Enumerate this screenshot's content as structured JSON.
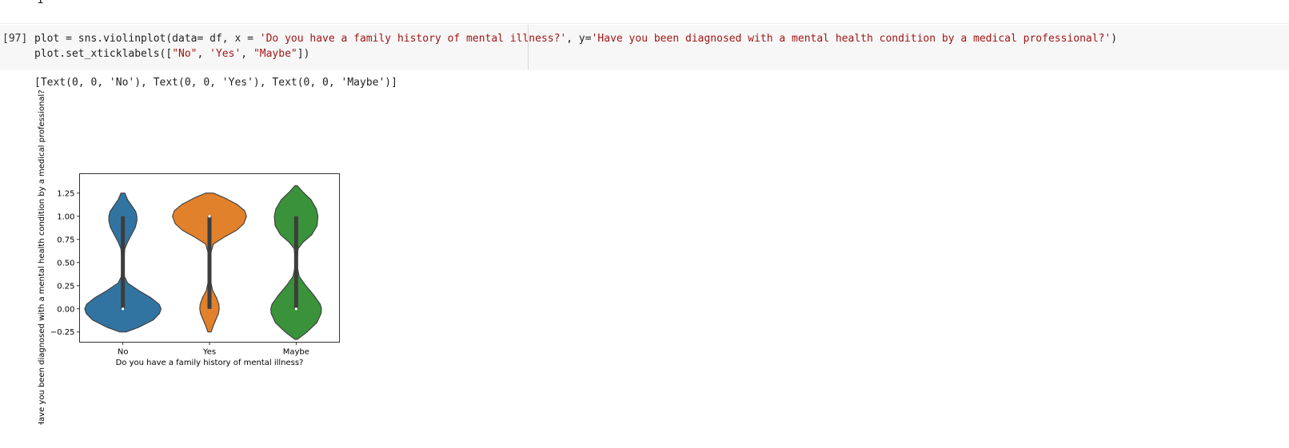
{
  "previous_output": "1",
  "cell": {
    "execution_count": "[97]",
    "code_line_1": [
      {
        "t": "plot = sns.violinplot(data= df, x = ",
        "s": false
      },
      {
        "t": "'Do you have a family history of mental illness?'",
        "s": true
      },
      {
        "t": ", y=",
        "s": false
      },
      {
        "t": "'Have you been diagnosed with a mental health condition by a medical professional?'",
        "s": true
      },
      {
        "t": ")",
        "s": false
      }
    ],
    "code_line_2": [
      {
        "t": "plot.set_xticklabels([",
        "s": false
      },
      {
        "t": "\"No\"",
        "s": true
      },
      {
        "t": ", ",
        "s": false
      },
      {
        "t": "'Yes'",
        "s": true
      },
      {
        "t": ", ",
        "s": false
      },
      {
        "t": "\"Maybe\"",
        "s": true
      },
      {
        "t": "])",
        "s": false
      }
    ]
  },
  "output_text": "[Text(0, 0, 'No'), Text(0, 0, 'Yes'), Text(0, 0, 'Maybe')]",
  "chart_data": {
    "type": "violin",
    "categories": [
      "No",
      "Yes",
      "Maybe"
    ],
    "xlabel": "Do you have a family history of mental illness?",
    "ylabel": "Have you been diagnosed with a mental health condition by a medical professional?",
    "ylim": [
      -0.36,
      1.46
    ],
    "yticks": [
      -0.25,
      0.0,
      0.25,
      0.5,
      0.75,
      1.0,
      1.25
    ],
    "ytick_labels": [
      "−0.25",
      "0.00",
      "0.25",
      "0.50",
      "0.75",
      "1.00",
      "1.25"
    ],
    "colors": [
      "#3274a1",
      "#e1812c",
      "#3a923a"
    ],
    "series": [
      {
        "name": "No",
        "extent": [
          -0.25,
          1.25
        ],
        "box": {
          "q1": 0.0,
          "q3": 1.0,
          "median": 0.0,
          "whisker_low": 0.0,
          "whisker_high": 1.0
        },
        "density": [
          [
            -0.25,
            0.08
          ],
          [
            -0.2,
            0.4
          ],
          [
            -0.12,
            0.78
          ],
          [
            -0.05,
            0.94
          ],
          [
            0.0,
            0.98
          ],
          [
            0.05,
            0.93
          ],
          [
            0.12,
            0.72
          ],
          [
            0.2,
            0.4
          ],
          [
            0.28,
            0.12
          ],
          [
            0.35,
            0.04
          ],
          [
            0.45,
            0.03
          ],
          [
            0.55,
            0.03
          ],
          [
            0.65,
            0.05
          ],
          [
            0.72,
            0.12
          ],
          [
            0.8,
            0.22
          ],
          [
            0.88,
            0.32
          ],
          [
            0.95,
            0.36
          ],
          [
            1.0,
            0.36
          ],
          [
            1.05,
            0.33
          ],
          [
            1.12,
            0.22
          ],
          [
            1.18,
            0.12
          ],
          [
            1.25,
            0.05
          ]
        ]
      },
      {
        "name": "Yes",
        "extent": [
          -0.25,
          1.25
        ],
        "box": {
          "q1": 0.0,
          "q3": 1.0,
          "median": 1.0,
          "whisker_low": 0.0,
          "whisker_high": 1.0
        },
        "density": [
          [
            -0.25,
            0.04
          ],
          [
            -0.18,
            0.1
          ],
          [
            -0.1,
            0.18
          ],
          [
            -0.05,
            0.23
          ],
          [
            0.0,
            0.25
          ],
          [
            0.05,
            0.24
          ],
          [
            0.12,
            0.18
          ],
          [
            0.2,
            0.08
          ],
          [
            0.3,
            0.03
          ],
          [
            0.45,
            0.02
          ],
          [
            0.6,
            0.03
          ],
          [
            0.7,
            0.1
          ],
          [
            0.78,
            0.4
          ],
          [
            0.85,
            0.7
          ],
          [
            0.92,
            0.88
          ],
          [
            1.0,
            0.95
          ],
          [
            1.06,
            0.9
          ],
          [
            1.13,
            0.7
          ],
          [
            1.2,
            0.38
          ],
          [
            1.25,
            0.1
          ]
        ]
      },
      {
        "name": "Maybe",
        "extent": [
          -0.33,
          1.33
        ],
        "box": {
          "q1": 0.0,
          "q3": 1.0,
          "median": 0.0,
          "whisker_low": 0.0,
          "whisker_high": 1.0
        },
        "density": [
          [
            -0.33,
            0.03
          ],
          [
            -0.25,
            0.28
          ],
          [
            -0.15,
            0.53
          ],
          [
            -0.05,
            0.64
          ],
          [
            0.0,
            0.65
          ],
          [
            0.05,
            0.62
          ],
          [
            0.15,
            0.45
          ],
          [
            0.25,
            0.25
          ],
          [
            0.35,
            0.08
          ],
          [
            0.45,
            0.03
          ],
          [
            0.55,
            0.03
          ],
          [
            0.65,
            0.05
          ],
          [
            0.72,
            0.18
          ],
          [
            0.8,
            0.4
          ],
          [
            0.9,
            0.54
          ],
          [
            1.0,
            0.56
          ],
          [
            1.08,
            0.52
          ],
          [
            1.18,
            0.38
          ],
          [
            1.26,
            0.18
          ],
          [
            1.33,
            0.03
          ]
        ]
      }
    ]
  }
}
